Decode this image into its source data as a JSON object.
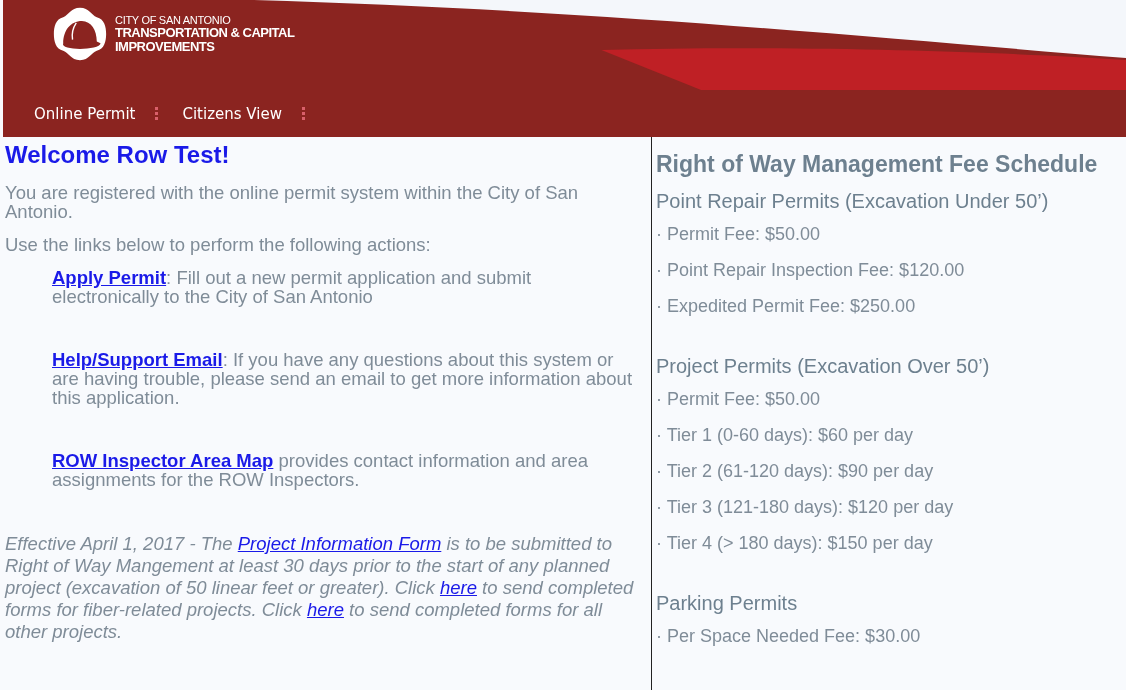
{
  "header": {
    "logo_lines": [
      "CITY OF SAN ANTONIO",
      "TRANSPORTATION & CAPITAL",
      "IMPROVEMENTS"
    ],
    "nav": [
      {
        "label": "Online Permit"
      },
      {
        "label": "Citizens View"
      }
    ]
  },
  "welcome": {
    "title": "Welcome Row  Test!",
    "intro": "You are registered with the online permit system within the City of San Antonio.",
    "prompt": "Use the links below to perform the following actions:",
    "actions": [
      {
        "link": "Apply Permit",
        "text": ": Fill out a new permit application and submit electronically to the City of San Antonio"
      },
      {
        "link": "Help/Support Email",
        "text": ": If you have any questions about this system or are having trouble, please send an email to get more information about this application."
      },
      {
        "link": "ROW Inspector Area Map",
        "text": " provides contact information and area assignments for the ROW Inspectors."
      }
    ],
    "notice": [
      {
        "kind": "text",
        "text": "Effective April 1, 2017 - The "
      },
      {
        "kind": "link",
        "text": "Project Information Form"
      },
      {
        "kind": "text",
        "text": " is to be submitted to Right of Way Mangement at least 30 days prior to the start of any planned project (excavation of 50 linear feet or greater).  Click "
      },
      {
        "kind": "link",
        "text": "here"
      },
      {
        "kind": "text",
        "text": " to send completed forms for fiber-related projects.  Click "
      },
      {
        "kind": "link",
        "text": "here"
      },
      {
        "kind": "text",
        "text": " to send completed forms for all other projects."
      }
    ]
  },
  "fee_schedule": {
    "title": "Right of Way Management Fee Schedule",
    "sections": [
      {
        "heading": "Point Repair Permits (Excavation Under 50’)",
        "items": [
          "· Permit Fee: $50.00",
          "· Point Repair Inspection Fee: $120.00",
          "· Expedited Permit Fee: $250.00"
        ]
      },
      {
        "heading": "Project Permits (Excavation Over 50’)",
        "items": [
          "· Permit Fee: $50.00",
          "· Tier 1 (0-60 days): $60 per day",
          "· Tier 2 (61-120 days): $90 per day",
          "· Tier 3 (121-180 days): $120 per day",
          "· Tier 4 (> 180 days): $150 per day"
        ]
      },
      {
        "heading": "Parking Permits",
        "items": [
          "· Per Space Needed Fee: $30.00"
        ]
      }
    ]
  }
}
